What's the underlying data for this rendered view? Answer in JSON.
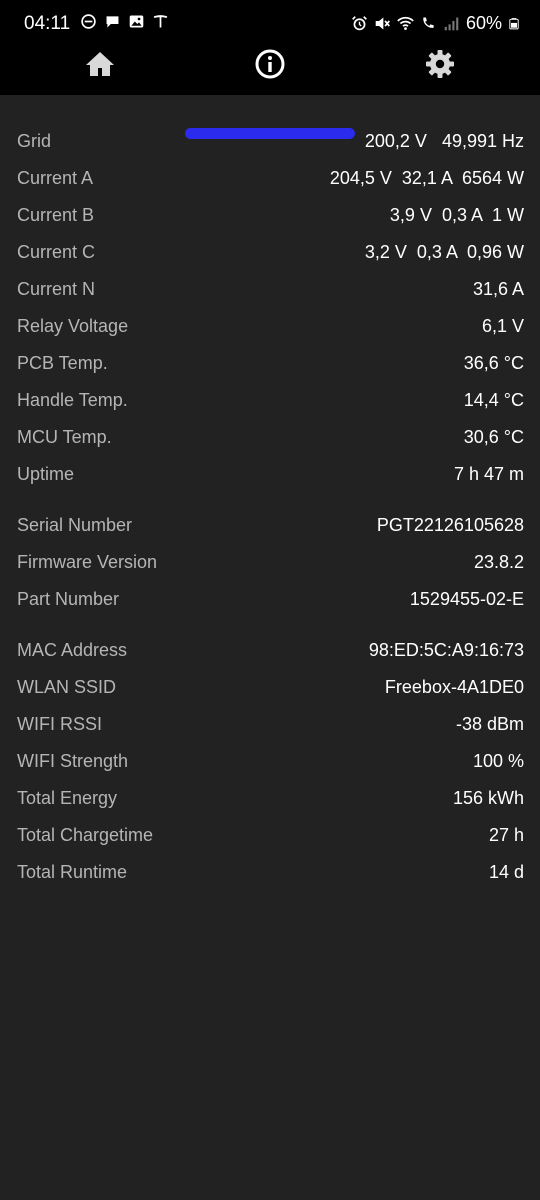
{
  "status_bar": {
    "time": "04:11",
    "battery": "60%"
  },
  "tabs": [
    {
      "name": "home",
      "icon": "home-icon"
    },
    {
      "name": "info",
      "icon": "info-icon"
    },
    {
      "name": "settings",
      "icon": "gear-icon"
    }
  ],
  "active_tab": "info",
  "accent_color": "#2b2bee",
  "rows": [
    {
      "label": "Grid",
      "value": "200,2 V   49,991 Hz"
    },
    {
      "label": "Current A",
      "value": "204,5 V  32,1 A  6564 W"
    },
    {
      "label": "Current B",
      "value": "3,9 V  0,3 A  1 W"
    },
    {
      "label": "Current C",
      "value": "3,2 V  0,3 A  0,96 W"
    },
    {
      "label": "Current N",
      "value": "31,6 A"
    },
    {
      "label": "Relay Voltage",
      "value": "6,1 V"
    },
    {
      "label": "PCB Temp.",
      "value": "36,6 °C"
    },
    {
      "label": "Handle Temp.",
      "value": "14,4 °C"
    },
    {
      "label": "MCU Temp.",
      "value": "30,6 °C"
    },
    {
      "label": "Uptime",
      "value": "7 h 47 m"
    },
    {
      "label": "Serial Number",
      "value": "PGT22126105628"
    },
    {
      "label": "Firmware Version",
      "value": "23.8.2"
    },
    {
      "label": "Part Number",
      "value": "1529455-02-E"
    },
    {
      "label": "MAC Address",
      "value": "98:ED:5C:A9:16:73"
    },
    {
      "label": "WLAN SSID",
      "value": "Freebox-4A1DE0"
    },
    {
      "label": "WIFI RSSI",
      "value": "-38 dBm"
    },
    {
      "label": "WIFI Strength",
      "value": "100 %"
    },
    {
      "label": "Total Energy",
      "value": "156 kWh"
    },
    {
      "label": "Total Chargetime",
      "value": "27 h"
    },
    {
      "label": "Total Runtime",
      "value": "14 d"
    }
  ]
}
